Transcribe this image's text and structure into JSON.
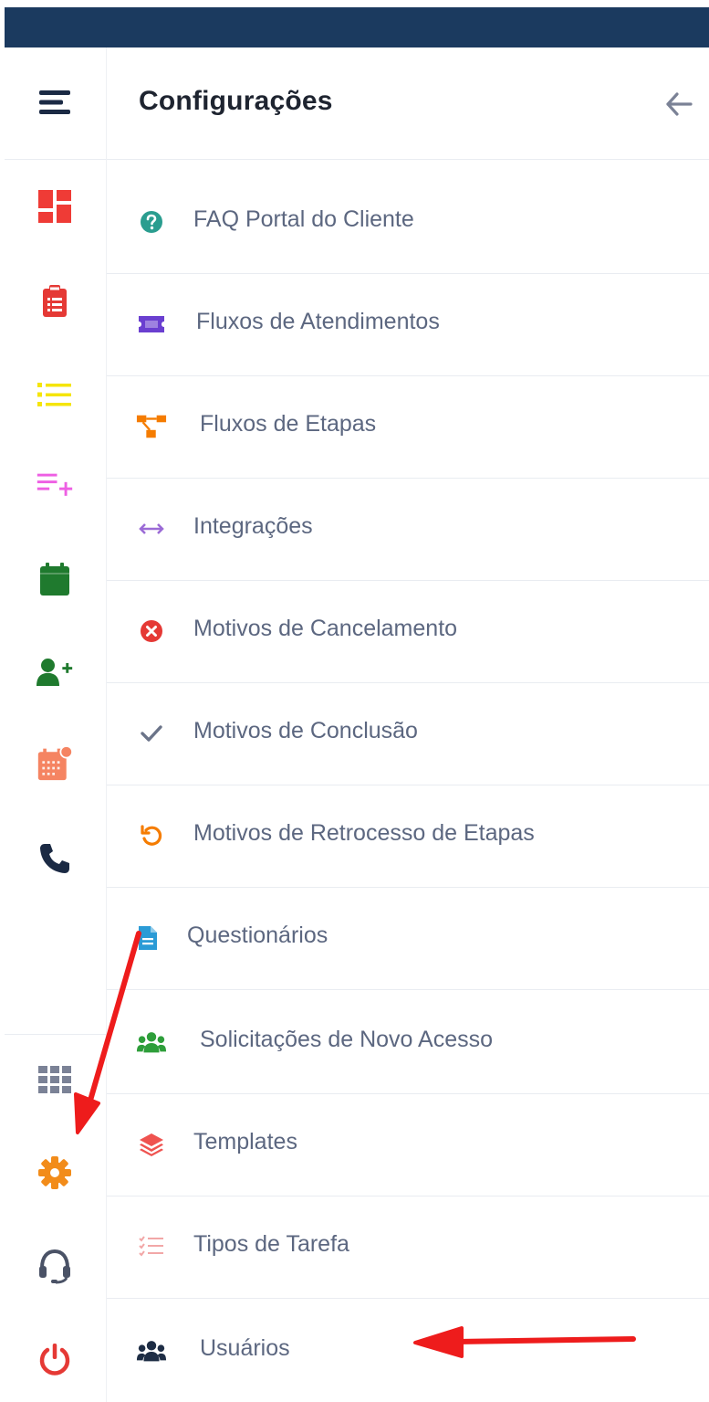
{
  "panel": {
    "title": "Configurações"
  },
  "rail": {
    "top_icons": [
      "hamburger-menu-icon",
      "dashboard-icon",
      "clipboard-icon",
      "list-icon",
      "playlist-add-icon",
      "calendar-icon",
      "user-plus-icon",
      "calendar-alert-icon",
      "phone-icon"
    ],
    "bottom_icons": [
      "apps-grid-icon",
      "settings-gear-icon",
      "headset-icon",
      "power-icon"
    ]
  },
  "menu": {
    "items": [
      {
        "label": "FAQ Portal do Cliente",
        "icon": "question-circle-icon",
        "color": "#2a9d8f"
      },
      {
        "label": "Fluxos de Atendimentos",
        "icon": "ticket-icon",
        "color": "#6a3fd0"
      },
      {
        "label": "Fluxos de Etapas",
        "icon": "flow-steps-icon",
        "color": "#f57c00"
      },
      {
        "label": "Integrações",
        "icon": "arrows-horizontal-icon",
        "color": "#9b6bd6"
      },
      {
        "label": "Motivos de Cancelamento",
        "icon": "cancel-circle-icon",
        "color": "#e53935"
      },
      {
        "label": "Motivos de Conclusão",
        "icon": "checkmark-icon",
        "color": "#6b7489"
      },
      {
        "label": "Motivos de Retrocesso de Etapas",
        "icon": "undo-icon",
        "color": "#f57c00"
      },
      {
        "label": "Questionários",
        "icon": "document-icon",
        "color": "#2b9bd6"
      },
      {
        "label": "Solicitações de Novo Acesso",
        "icon": "group-icon",
        "color": "#2e9e3a"
      },
      {
        "label": "Templates",
        "icon": "layers-icon",
        "color": "#ef5350"
      },
      {
        "label": "Tipos de Tarefa",
        "icon": "checklist-icon",
        "color": "#f2a7a7"
      },
      {
        "label": "Usuários",
        "icon": "users-icon",
        "color": "#1e2d45"
      }
    ]
  },
  "colors": {
    "topbar": "#1b3a5f",
    "annotation_arrows": "#ee1c1c"
  }
}
